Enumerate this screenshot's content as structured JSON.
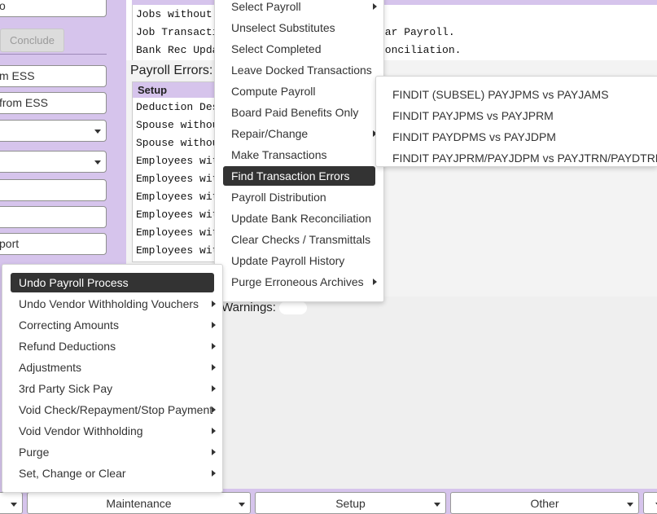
{
  "left_panel": {
    "top_field": "o",
    "conclude_label": "Conclude",
    "fields": [
      {
        "value": "m ESS",
        "type": "text"
      },
      {
        "value": "from ESS",
        "type": "text"
      },
      {
        "value": "",
        "type": "select"
      },
      {
        "value": "",
        "type": "select"
      },
      {
        "value": "",
        "type": "text"
      },
      {
        "value": "",
        "type": "text"
      },
      {
        "value": "port",
        "type": "text"
      }
    ]
  },
  "top_list": {
    "header_left": "Payroll",
    "header_right": "Errors",
    "rows": [
      {
        "left": "Jobs without Ch",
        "right": ""
      },
      {
        "left": "Job Transactions",
        "right": "ear Payroll."
      },
      {
        "left": "Bank Rec Updat",
        "right": "conciliation."
      }
    ]
  },
  "payroll_errors": {
    "label": "Payroll Errors:",
    "header": "Setup",
    "rows": [
      "Deduction Descr",
      "Spouse without",
      "Spouse without",
      "Employees witho",
      "Employees witho",
      "Employees witho",
      "Employees witho",
      "Employees witho",
      "Employees witho"
    ]
  },
  "warnings": {
    "label": "Warnings:"
  },
  "payroll_menu": {
    "items": [
      {
        "label": "Select Payroll",
        "submenu": true,
        "active": false
      },
      {
        "label": "Unselect Substitutes",
        "submenu": false,
        "active": false
      },
      {
        "label": "Select Completed",
        "submenu": false,
        "active": false
      },
      {
        "label": "Leave Docked Transactions",
        "submenu": false,
        "active": false
      },
      {
        "label": "Compute Payroll",
        "submenu": false,
        "active": false
      },
      {
        "label": "Board Paid Benefits Only",
        "submenu": false,
        "active": false
      },
      {
        "label": "Repair/Change",
        "submenu": true,
        "active": false
      },
      {
        "label": "Make Transactions",
        "submenu": false,
        "active": false
      },
      {
        "label": "Find Transaction Errors",
        "submenu": false,
        "active": true
      },
      {
        "label": "Payroll Distribution",
        "submenu": false,
        "active": false
      },
      {
        "label": "Update Bank Reconciliation",
        "submenu": false,
        "active": false
      },
      {
        "label": "Clear Checks / Transmittals",
        "submenu": false,
        "active": false
      },
      {
        "label": "Update Payroll History",
        "submenu": false,
        "active": false
      },
      {
        "label": "Purge Erroneous Archives",
        "submenu": true,
        "active": false
      }
    ]
  },
  "findit_menu": {
    "items": [
      "FINDIT (SUBSEL) PAYJPMS vs PAYJAMS",
      "FINDIT PAYJPMS vs PAYJPRM",
      "FINDIT PAYDPMS vs PAYJDPM",
      "FINDIT PAYJPRM/PAYJDPM vs PAYJTRN/PAYDTRN"
    ]
  },
  "maintenance_menu": {
    "items": [
      {
        "label": "Undo Payroll Process",
        "submenu": false,
        "active": true
      },
      {
        "label": "Undo Vendor Withholding Vouchers",
        "submenu": true,
        "active": false
      },
      {
        "label": "Correcting Amounts",
        "submenu": true,
        "active": false
      },
      {
        "label": "Refund Deductions",
        "submenu": true,
        "active": false
      },
      {
        "label": "Adjustments",
        "submenu": true,
        "active": false
      },
      {
        "label": "3rd Party Sick Pay",
        "submenu": true,
        "active": false
      },
      {
        "label": "Void Check/Repayment/Stop Payment",
        "submenu": true,
        "active": false
      },
      {
        "label": "Void Vendor Withholding",
        "submenu": true,
        "active": false
      },
      {
        "label": "Purge",
        "submenu": true,
        "active": false
      },
      {
        "label": "Set, Change or Clear",
        "submenu": true,
        "active": false
      }
    ]
  },
  "bottom_tabs": [
    "",
    "Maintenance",
    "Setup",
    "Other",
    ""
  ]
}
